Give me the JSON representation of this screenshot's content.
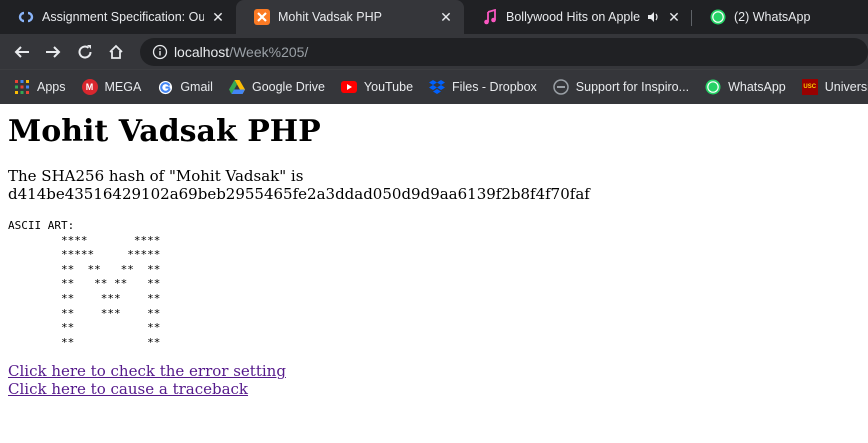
{
  "browser": {
    "tabs": [
      {
        "title": "Assignment Specification: Our",
        "icon": "coursera-icon"
      },
      {
        "title": "Mohit Vadsak PHP",
        "icon": "xampp-icon"
      },
      {
        "title": "Bollywood Hits on Apple M",
        "icon": "apple-music-icon"
      },
      {
        "title": "(2) WhatsApp",
        "icon": "whatsapp-icon",
        "badge": "2"
      }
    ],
    "close_glyph": "✕",
    "url": {
      "host": "localhost",
      "path": "/Week%205/"
    },
    "bookmarks": [
      {
        "label": "Apps"
      },
      {
        "label": "MEGA",
        "icon_text": "M"
      },
      {
        "label": "Gmail"
      },
      {
        "label": "Google Drive"
      },
      {
        "label": "YouTube"
      },
      {
        "label": "Files - Dropbox"
      },
      {
        "label": "Support for Inspiro..."
      },
      {
        "label": "WhatsApp"
      },
      {
        "label": "University",
        "icon_text": "USC"
      }
    ],
    "colors": {
      "tab_active": "#35363a",
      "frame": "#202124",
      "link_visited": "#551a8b"
    }
  },
  "page": {
    "heading": "Mohit Vadsak PHP",
    "hash_text": "The SHA256 hash of \"Mohit Vadsak\" is d414be43516429102a69beb2955465fe2a3ddad050d9d9aa6139f2b8f4f70faf",
    "ascii_art": "ASCII ART:\n        ****       ****\n        *****     *****\n        **  **   **  **\n        **   ** **   **\n        **    ***    **\n        **    ***    **\n        **           **\n        **           **",
    "links": [
      {
        "label": "Click here to check the error setting"
      },
      {
        "label": "Click here to cause a traceback"
      }
    ]
  }
}
